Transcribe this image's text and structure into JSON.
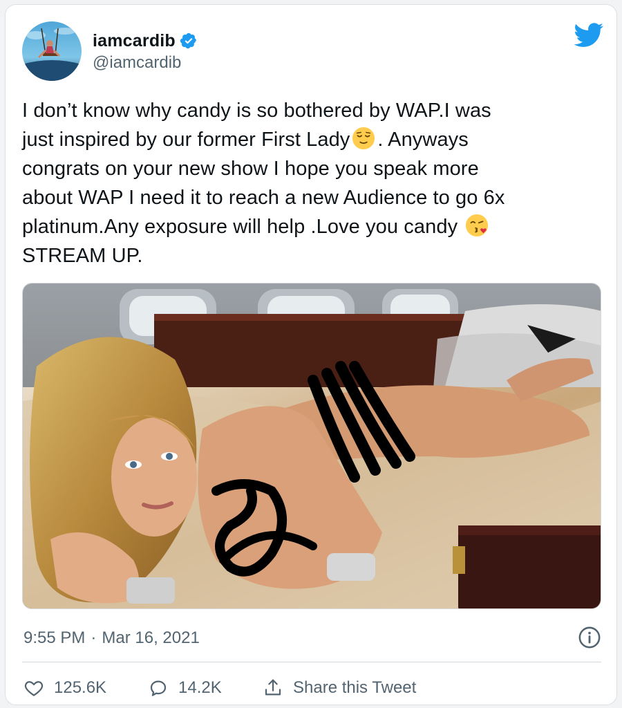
{
  "user": {
    "display_name": "iamcardib",
    "handle": "@iamcardib",
    "verified": true
  },
  "tweet": {
    "line1": "I don’t know why candy is so bothered by WAP.I was",
    "line2a": "just inspired by our former First Lady",
    "line2b": ". Anyways",
    "line3": "congrats on your new show I hope you speak more",
    "line4": "about WAP I need it to reach a new Audience to go 6x",
    "line5": "platinum.Any exposure will help .Love you candy",
    "line6": "STREAM UP.",
    "emoji_1": "relieved-face-emoji",
    "emoji_2": "face-blowing-kiss-emoji"
  },
  "media": {
    "description_icon": "photo-with-redaction-scribbles"
  },
  "meta": {
    "time": "9:55 PM",
    "separator": "·",
    "date": "Mar 16, 2021"
  },
  "actions": {
    "likes": "125.6K",
    "replies": "14.2K",
    "share_label": "Share this Tweet"
  },
  "colors": {
    "verified_blue": "#1d9bf0",
    "twitter_blue": "#1d9bf0",
    "muted": "#536471",
    "text": "#0f1419"
  }
}
